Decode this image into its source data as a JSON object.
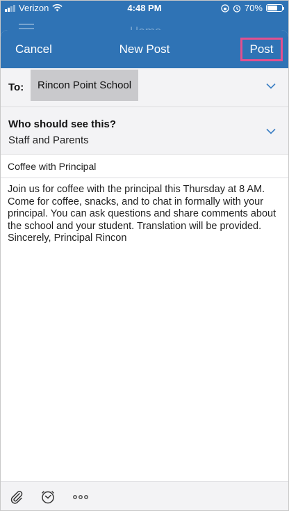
{
  "status_bar": {
    "carrier": "Verizon",
    "time": "4:48 PM",
    "battery": "70%",
    "battery_level": 0.7
  },
  "background_app": {
    "title": "Home"
  },
  "navbar": {
    "cancel_label": "Cancel",
    "title": "New Post",
    "post_label": "Post"
  },
  "to_row": {
    "label": "To:",
    "recipient": "Rincon Point School"
  },
  "audience_row": {
    "question": "Who should see this?",
    "value": "Staff and Parents"
  },
  "post": {
    "subject": "Coffee with Principal",
    "body": "Join us for coffee with the principal this Thursday at 8 AM. Come for coffee, snacks, and to chat in formally with your principal. You can ask questions and share comments about the school and your student. Translation will be provided. Sincerely, Principal Rincon"
  },
  "colors": {
    "brand_blue": "#2f73b5",
    "highlight_pink": "#e2508f",
    "chevron_blue": "#3b7fc4"
  },
  "toolbar": {
    "icons": [
      "paperclip-icon",
      "clock-icon",
      "more-icon"
    ]
  }
}
